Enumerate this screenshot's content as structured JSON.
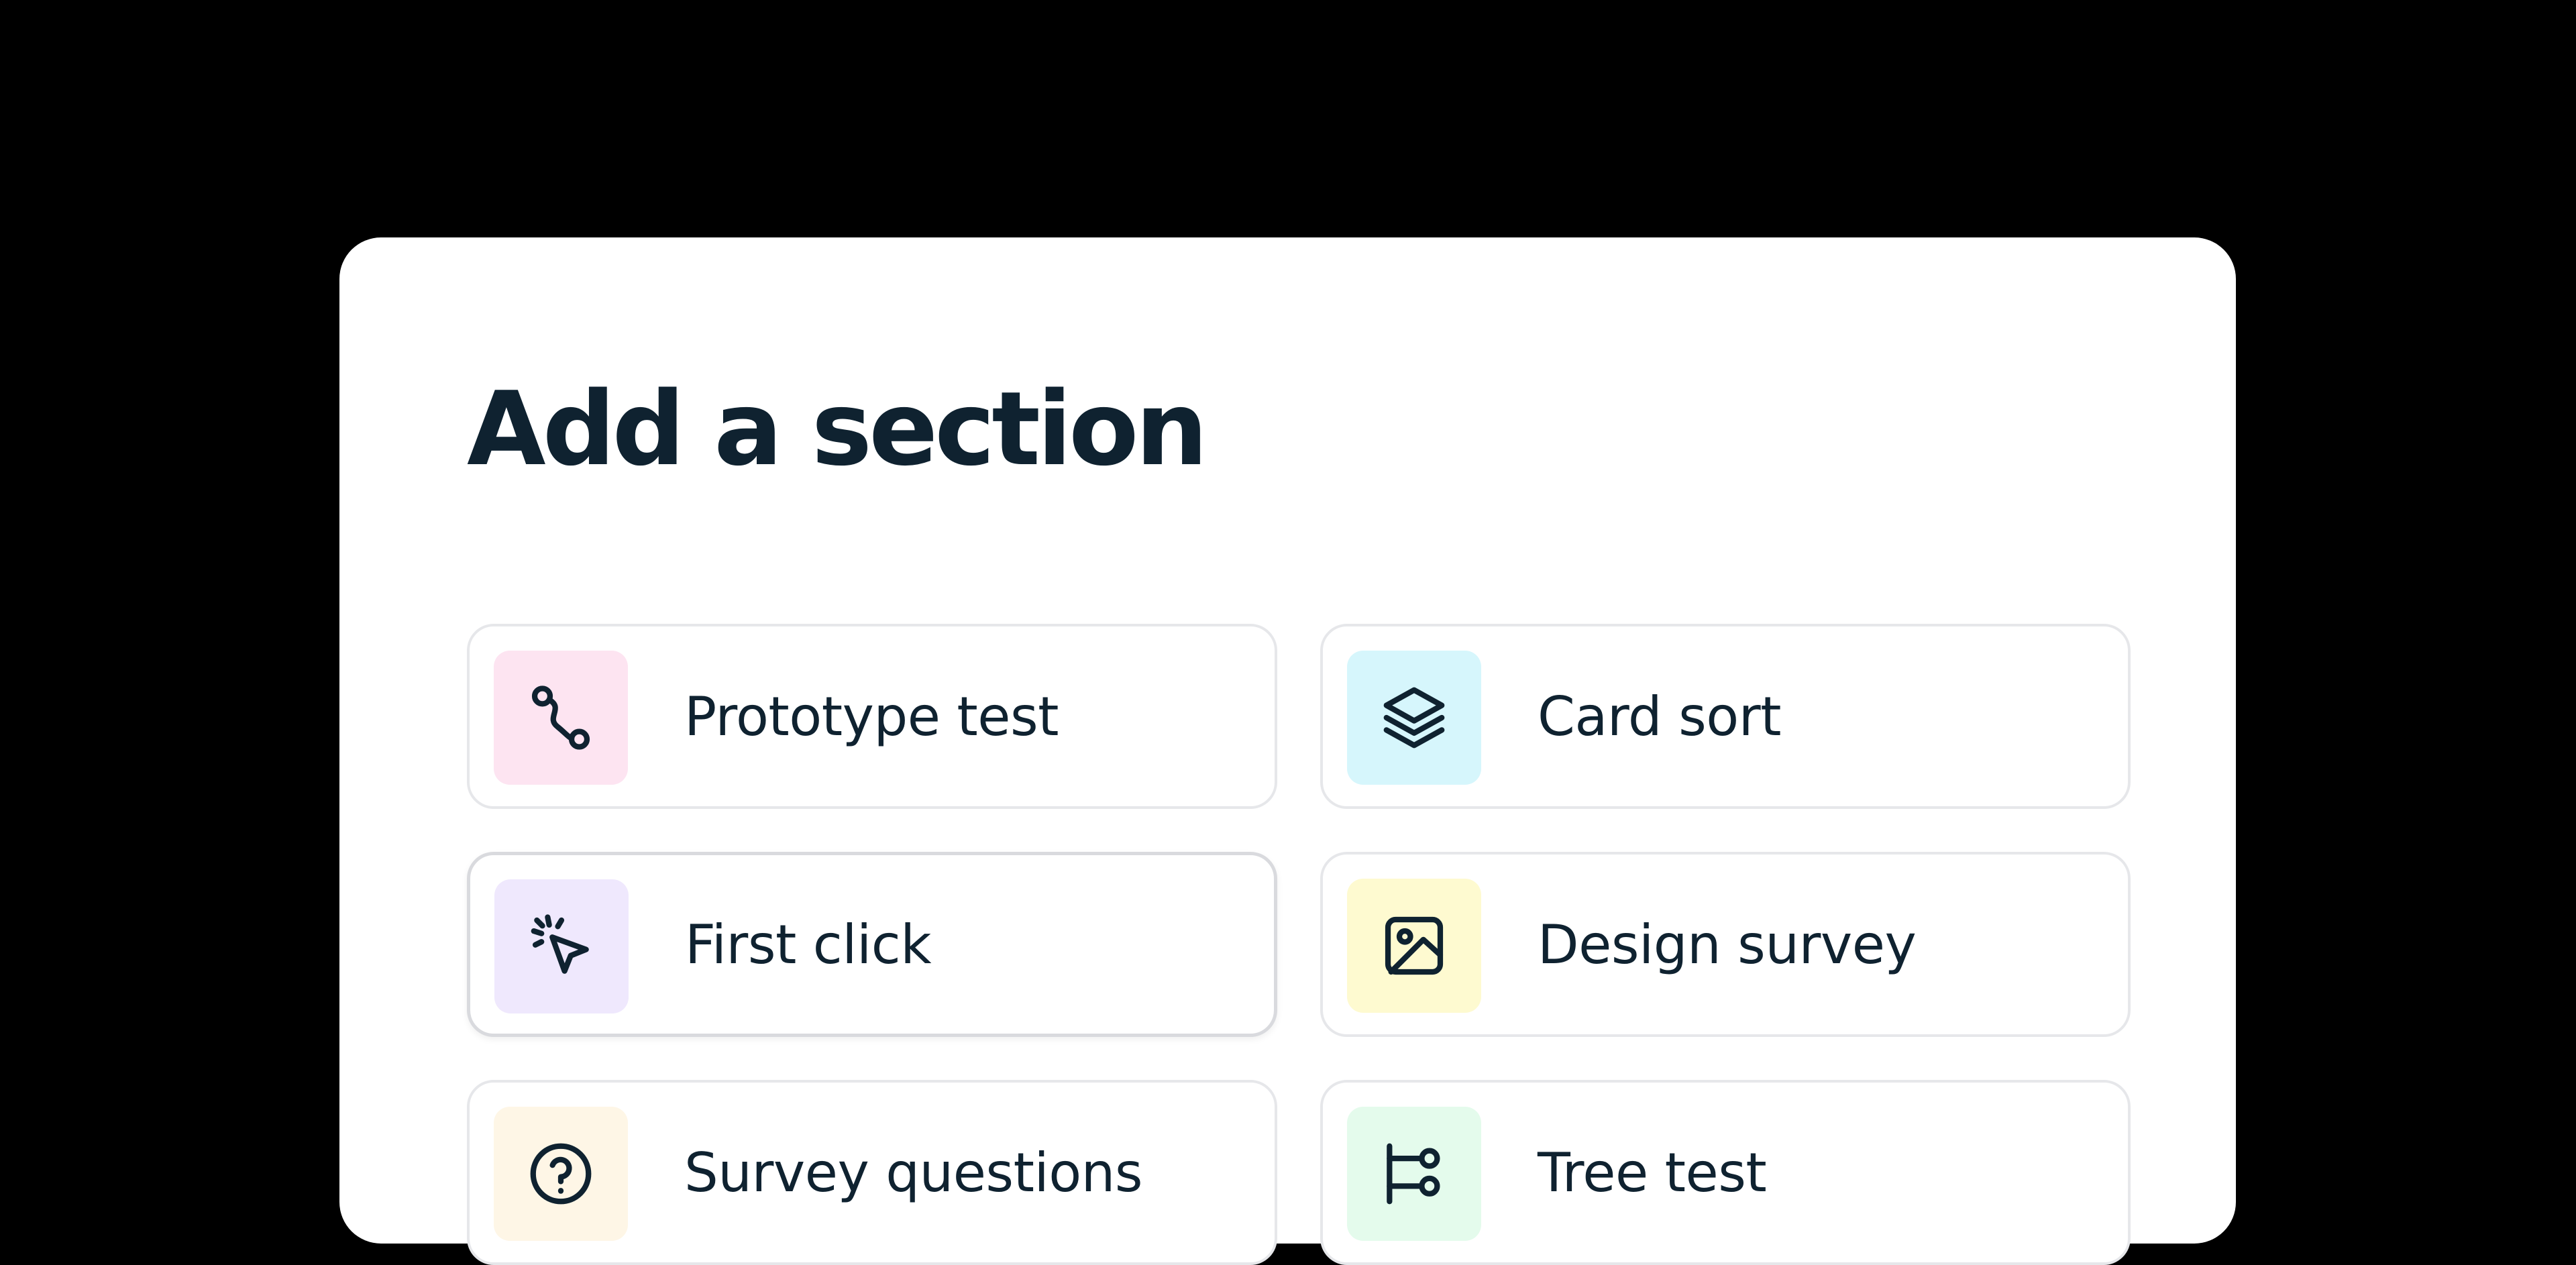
{
  "dialog": {
    "title": "Add a section"
  },
  "options": [
    {
      "label": "Prototype test",
      "icon": "route-icon",
      "tile_color": "#fde4f1"
    },
    {
      "label": "Card sort",
      "icon": "layers-icon",
      "tile_color": "#d6f6fc"
    },
    {
      "label": "First click",
      "icon": "click-pointer-icon",
      "tile_color": "#efe8fd"
    },
    {
      "label": "Design survey",
      "icon": "image-icon",
      "tile_color": "#fefad0"
    },
    {
      "label": "Survey questions",
      "icon": "question-circle-icon",
      "tile_color": "#fef6e6"
    },
    {
      "label": "Tree test",
      "icon": "tree-icon",
      "tile_color": "#e4fbec"
    }
  ],
  "colors": {
    "background": "#000000",
    "panel": "#ffffff",
    "text": "#0f2230",
    "card_border": "#e6e7ea"
  }
}
